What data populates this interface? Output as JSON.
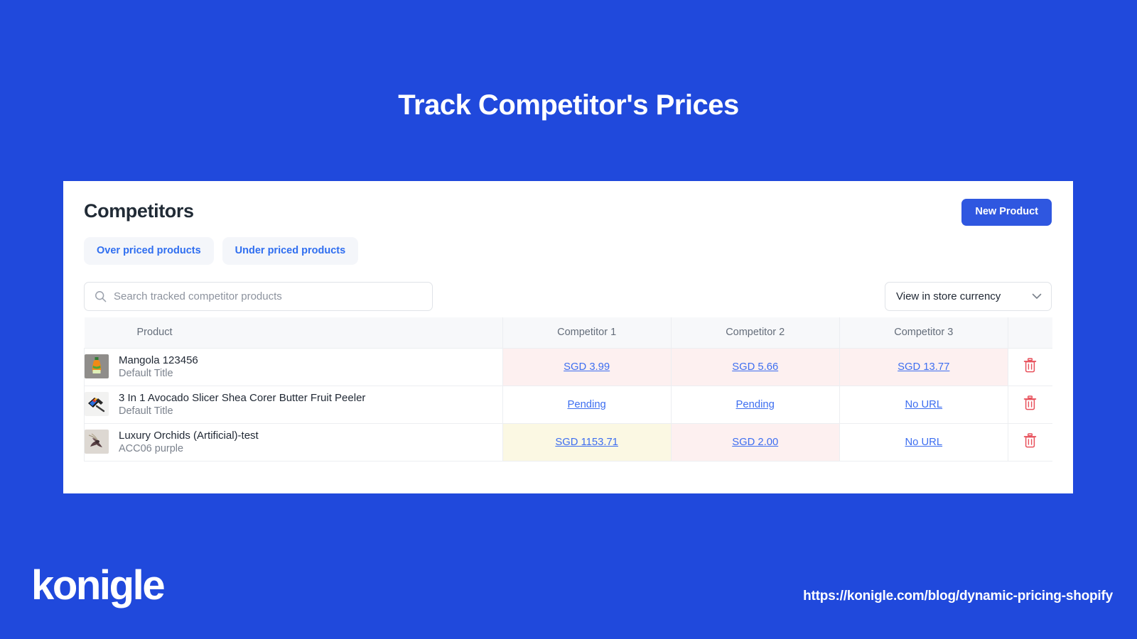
{
  "hero": {
    "title": "Track Competitor's Prices",
    "background_color": "#2049dc"
  },
  "card": {
    "title": "Competitors",
    "new_product_label": "New Product",
    "new_product_color": "#2f57e0",
    "filters": [
      {
        "label": "Over priced products"
      },
      {
        "label": "Under priced products"
      }
    ],
    "search": {
      "placeholder": "Search tracked competitor products",
      "value": "",
      "icon": "search-icon"
    },
    "currency_select": {
      "selected": "View in store currency",
      "icon": "chevron-down-icon"
    },
    "table": {
      "columns": [
        "Product",
        "Competitor 1",
        "Competitor 2",
        "Competitor 3",
        ""
      ],
      "rows": [
        {
          "product": "Mangola 123456",
          "variant": "Default Title",
          "thumb": "mangola-bottle-thumbnail",
          "cells": [
            {
              "label": "SGD 3.99",
              "state": "over"
            },
            {
              "label": "SGD 5.66",
              "state": "over"
            },
            {
              "label": "SGD 13.77",
              "state": "over"
            }
          ],
          "delete_icon": "trash-icon"
        },
        {
          "product": "3 In 1 Avocado Slicer Shea Corer Butter Fruit Peeler",
          "variant": "Default Title",
          "thumb": "avocado-slicer-thumbnail",
          "cells": [
            {
              "label": "Pending",
              "state": "none"
            },
            {
              "label": "Pending",
              "state": "none"
            },
            {
              "label": "No URL",
              "state": "none"
            }
          ],
          "delete_icon": "trash-icon"
        },
        {
          "product": "Luxury Orchids (Artificial)-test",
          "variant": "ACC06 purple",
          "thumb": "orchid-thumbnail",
          "cells": [
            {
              "label": "SGD 1153.71",
              "state": "under"
            },
            {
              "label": "SGD 2.00",
              "state": "over"
            },
            {
              "label": "No URL",
              "state": "none"
            }
          ],
          "delete_icon": "trash-icon"
        }
      ]
    }
  },
  "footer": {
    "logo_text": "konigle",
    "url": "https://konigle.com/blog/dynamic-pricing-shopify"
  },
  "colors": {
    "brand_blue": "#2049dc",
    "link_blue": "#3d6ef0",
    "over_priced_bg": "#fdf0f0",
    "under_priced_bg": "#fbf8e3",
    "danger_red": "#e8505b"
  }
}
